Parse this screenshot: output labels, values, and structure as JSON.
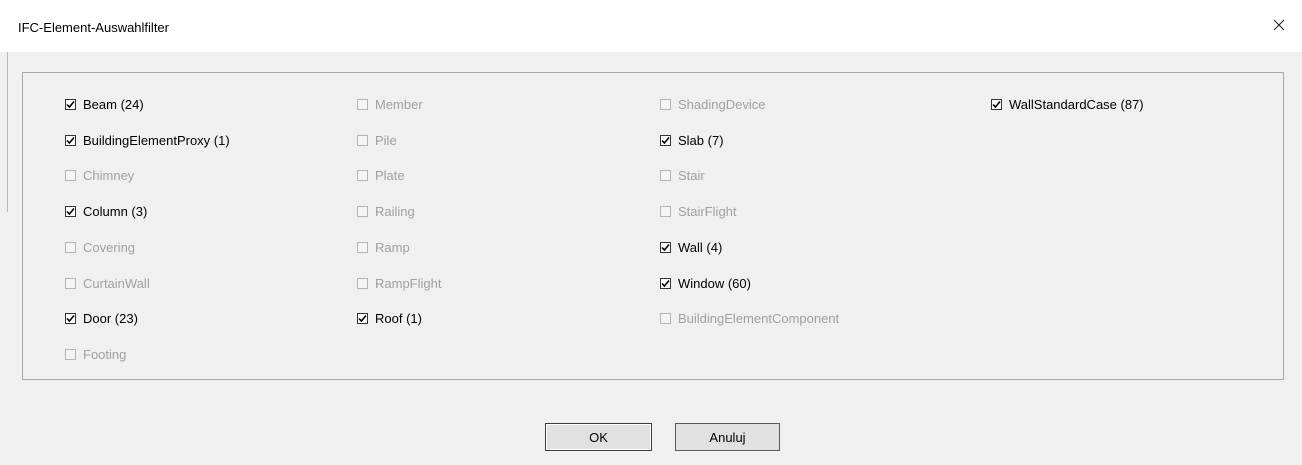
{
  "window": {
    "title": "IFC-Element-Auswahlfilter",
    "close_symbol": "×"
  },
  "filter": {
    "columns": [
      {
        "items": [
          {
            "label": "Beam (24)",
            "checked": true,
            "enabled": true
          },
          {
            "label": "BuildingElementProxy (1)",
            "checked": true,
            "enabled": true
          },
          {
            "label": "Chimney",
            "checked": false,
            "enabled": false
          },
          {
            "label": "Column (3)",
            "checked": true,
            "enabled": true
          },
          {
            "label": "Covering",
            "checked": false,
            "enabled": false
          },
          {
            "label": "CurtainWall",
            "checked": false,
            "enabled": false
          },
          {
            "label": "Door (23)",
            "checked": true,
            "enabled": true
          },
          {
            "label": "Footing",
            "checked": false,
            "enabled": false
          }
        ]
      },
      {
        "items": [
          {
            "label": "Member",
            "checked": false,
            "enabled": false
          },
          {
            "label": "Pile",
            "checked": false,
            "enabled": false
          },
          {
            "label": "Plate",
            "checked": false,
            "enabled": false
          },
          {
            "label": "Railing",
            "checked": false,
            "enabled": false
          },
          {
            "label": "Ramp",
            "checked": false,
            "enabled": false
          },
          {
            "label": "RampFlight",
            "checked": false,
            "enabled": false
          },
          {
            "label": "Roof (1)",
            "checked": true,
            "enabled": true
          }
        ]
      },
      {
        "items": [
          {
            "label": "ShadingDevice",
            "checked": false,
            "enabled": false
          },
          {
            "label": "Slab (7)",
            "checked": true,
            "enabled": true
          },
          {
            "label": "Stair",
            "checked": false,
            "enabled": false
          },
          {
            "label": "StairFlight",
            "checked": false,
            "enabled": false
          },
          {
            "label": "Wall (4)",
            "checked": true,
            "enabled": true
          },
          {
            "label": "Window (60)",
            "checked": true,
            "enabled": true
          },
          {
            "label": "BuildingElementComponent",
            "checked": false,
            "enabled": false
          }
        ]
      },
      {
        "items": [
          {
            "label": "WallStandardCase (87)",
            "checked": true,
            "enabled": true
          }
        ]
      }
    ]
  },
  "buttons": {
    "ok_label": "OK",
    "cancel_label": "Anuluj"
  }
}
